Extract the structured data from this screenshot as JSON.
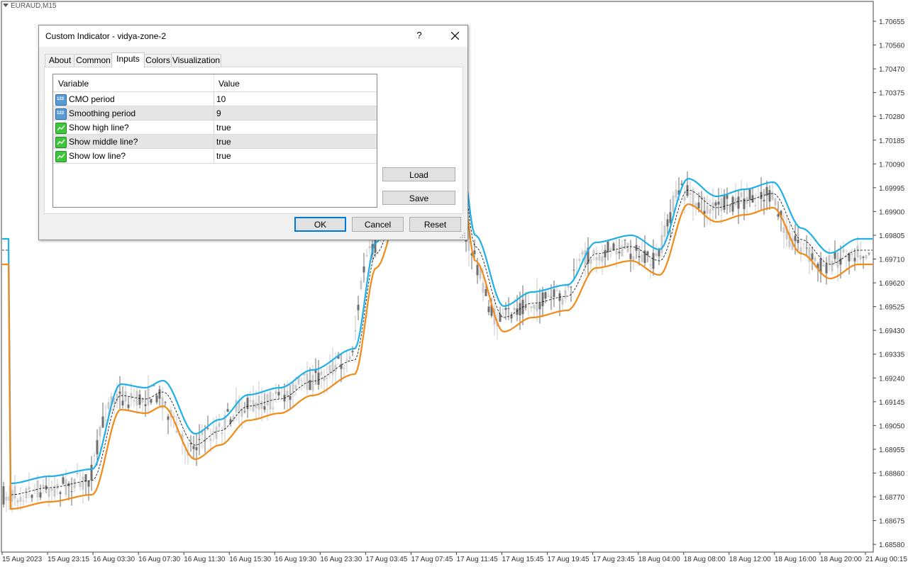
{
  "chart": {
    "symbol": "EURAUD,M15",
    "price_labels": [
      "1.70655",
      "1.70560",
      "1.70470",
      "1.70375",
      "1.70280",
      "1.70185",
      "1.70090",
      "1.69995",
      "1.69900",
      "1.69805",
      "1.69710",
      "1.69620",
      "1.69525",
      "1.69430",
      "1.69335",
      "1.69240",
      "1.69145",
      "1.69050",
      "1.68955",
      "1.68860",
      "1.68770",
      "1.68675",
      "1.68580"
    ],
    "time_labels": [
      "15 Aug 2023",
      "15 Aug 23:15",
      "16 Aug 03:30",
      "16 Aug 07:30",
      "16 Aug 11:30",
      "16 Aug 15:30",
      "16 Aug 19:30",
      "16 Aug 23:30",
      "17 Aug 03:45",
      "17 Aug 07:45",
      "17 Aug 11:45",
      "17 Aug 15:45",
      "17 Aug 19:45",
      "17 Aug 23:45",
      "18 Aug 04:00",
      "18 Aug 08:00",
      "18 Aug 12:00",
      "18 Aug 16:00",
      "18 Aug 20:00",
      "21 Aug 00:15"
    ],
    "colors": {
      "high_line": "#1fb0e8",
      "low_line": "#f28a17",
      "mid_line": "#000000",
      "candle_bull": "#c8c8c8",
      "candle_bear": "#6e6e6e"
    }
  },
  "dialog": {
    "title": "Custom Indicator - vidya-zone-2",
    "help": "?",
    "tabs": [
      "About",
      "Common",
      "Inputs",
      "Colors",
      "Visualization"
    ],
    "active_tab": "Inputs",
    "columns": {
      "variable": "Variable",
      "value": "Value"
    },
    "params": [
      {
        "icon": "number-icon",
        "icon_text": "123",
        "variable": "CMO period",
        "value": "10"
      },
      {
        "icon": "number-icon",
        "icon_text": "123",
        "variable": "Smoothing period",
        "value": "9"
      },
      {
        "icon": "boolean-icon",
        "variable": "Show high line?",
        "value": "true"
      },
      {
        "icon": "boolean-icon",
        "variable": "Show middle line?",
        "value": "true"
      },
      {
        "icon": "boolean-icon",
        "variable": "Show low line?",
        "value": "true"
      }
    ],
    "buttons": {
      "load": "Load",
      "save": "Save",
      "ok": "OK",
      "cancel": "Cancel",
      "reset": "Reset"
    }
  }
}
